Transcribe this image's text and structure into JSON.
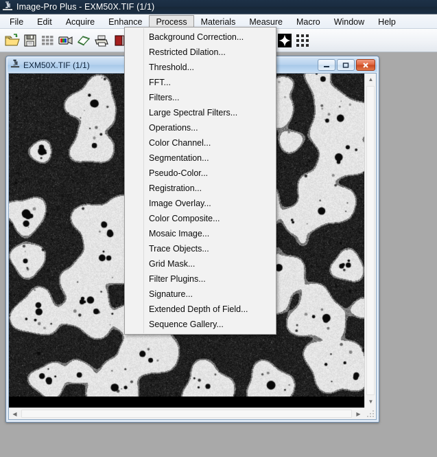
{
  "window": {
    "title": "Image-Pro Plus - EXM50X.TIF (1/1)",
    "app_icon": "microscope-icon"
  },
  "menubar": {
    "items": [
      {
        "label": "File",
        "open": false
      },
      {
        "label": "Edit",
        "open": false
      },
      {
        "label": "Acquire",
        "open": false
      },
      {
        "label": "Enhance",
        "open": false
      },
      {
        "label": "Process",
        "open": true
      },
      {
        "label": "Materials",
        "open": false
      },
      {
        "label": "Measure",
        "open": false
      },
      {
        "label": "Macro",
        "open": false
      },
      {
        "label": "Window",
        "open": false
      },
      {
        "label": "Help",
        "open": false
      }
    ]
  },
  "toolbar": {
    "buttons": [
      {
        "icon": "open-folder-icon",
        "title": "Open"
      },
      {
        "icon": "save-floppy-icon",
        "title": "Save"
      },
      {
        "icon": "grid-thumbnails-icon",
        "title": "Thumbnails"
      },
      {
        "icon": "video-camera-icon",
        "title": "Capture"
      },
      {
        "icon": "eraser-icon",
        "title": "Erase"
      },
      {
        "icon": "printer-icon",
        "title": "Print"
      },
      {
        "icon": "book-red-icon",
        "title": "Notes"
      },
      {
        "sep": true
      },
      {
        "icon": "pencil-icon",
        "title": "Draw"
      },
      {
        "sep": true
      },
      {
        "icon": "magnifier-icon",
        "title": "Zoom"
      },
      {
        "icon": "hand-pan-icon",
        "title": "Pan"
      },
      {
        "sep": true
      },
      {
        "icon": "contrast-sliders-icon",
        "title": "Contrast"
      },
      {
        "icon": "histogram-icon",
        "title": "Histogram"
      },
      {
        "icon": "levels-sliders-icon",
        "title": "Levels"
      },
      {
        "icon": "layers-icon",
        "title": "Layers"
      },
      {
        "icon": "sharpen-star-icon",
        "title": "Sharpen"
      },
      {
        "icon": "matrix-filter-icon",
        "title": "Filter"
      }
    ]
  },
  "dropdown": {
    "owner": "Process",
    "items": [
      {
        "label": "Background Correction..."
      },
      {
        "label": "Restricted Dilation..."
      },
      {
        "label": "Threshold..."
      },
      {
        "label": "FFT..."
      },
      {
        "label": "Filters..."
      },
      {
        "label": "Large Spectral Filters..."
      },
      {
        "label": "Operations..."
      },
      {
        "label": "Color Channel..."
      },
      {
        "label": "Segmentation..."
      },
      {
        "label": "Pseudo-Color..."
      },
      {
        "label": "Registration..."
      },
      {
        "label": "Image Overlay..."
      },
      {
        "label": "Color Composite..."
      },
      {
        "label": "Mosaic Image..."
      },
      {
        "label": "Trace Objects..."
      },
      {
        "label": "Grid Mask..."
      },
      {
        "label": "Filter Plugins..."
      },
      {
        "label": "Signature..."
      },
      {
        "label": "Extended Depth of Field..."
      },
      {
        "label": "Sequence Gallery..."
      }
    ]
  },
  "image_window": {
    "title": "EXM50X.TIF (1/1)",
    "icon": "microscope-icon",
    "controls": {
      "minimize": "–",
      "maximize": "▭",
      "close": "✕"
    },
    "scrollbars": {
      "up_arrow": "▲",
      "down_arrow": "▼",
      "left_arrow": "◀",
      "right_arrow": "▶"
    },
    "content": "grayscale micrograph of light particles on dark background"
  }
}
